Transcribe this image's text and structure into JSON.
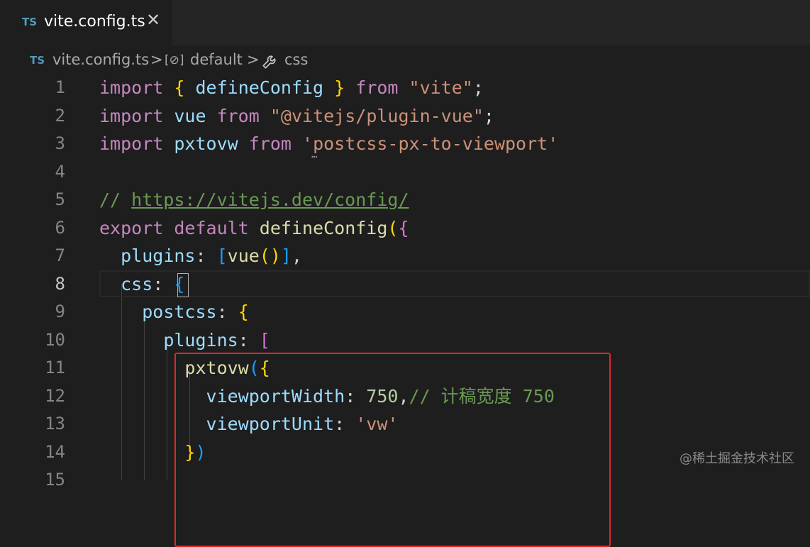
{
  "tab": {
    "lang_badge": "TS",
    "filename": "vite.config.ts",
    "close_glyph": "✕"
  },
  "breadcrumb": {
    "lang_badge": "TS",
    "file": "vite.config.ts",
    "sep": ">",
    "symbol_icon": "[⊘]",
    "symbol": "default",
    "wrench_icon": "🔧",
    "property": "css"
  },
  "line_numbers": [
    "1",
    "2",
    "3",
    "4",
    "5",
    "6",
    "7",
    "8",
    "9",
    "10",
    "11",
    "12",
    "13",
    "14",
    "15"
  ],
  "active_line": "8",
  "code": {
    "l1": [
      "import",
      " ",
      "{",
      " defineConfig ",
      "}",
      " from ",
      "\"vite\"",
      ";"
    ],
    "l2": [
      "import",
      " vue ",
      "from",
      " ",
      "\"@vitejs/plugin-vue\"",
      ";"
    ],
    "l3": [
      "import",
      " pxtovw ",
      "from",
      " ",
      "'postcss-px-to-viewport'"
    ],
    "l5": [
      "// ",
      "https://vitejs.dev/config/"
    ],
    "l6": [
      "export",
      " ",
      "default",
      " ",
      "defineConfig",
      "(",
      "{"
    ],
    "l7": [
      "  ",
      "plugins",
      ": ",
      "[",
      "vue",
      "()",
      "]",
      ","
    ],
    "l8": [
      "  ",
      "css",
      ": ",
      "{"
    ],
    "l9": [
      "    ",
      "postcss",
      ": ",
      "{"
    ],
    "l10": [
      "      ",
      "plugins",
      ": ",
      "["
    ],
    "l11": [
      "        ",
      "pxtovw",
      "(",
      "{"
    ],
    "l12": [
      "          ",
      "viewportWidth",
      ": ",
      "750",
      ",",
      "// 计稿宽度 750"
    ],
    "l13": [
      "          ",
      "viewportUnit",
      ": ",
      "'vw'"
    ],
    "l14": [
      "        ",
      "}",
      ")"
    ]
  },
  "hover_dots": "…",
  "watermark": "@稀土掘金技术社区",
  "colors": {
    "keyword": "#c586c0",
    "string": "#ce9178",
    "variable": "#9cdcfe",
    "function": "#dcdcaa",
    "comment": "#6a9955",
    "number": "#b5cea8",
    "highlight_box": "#e0262a"
  }
}
